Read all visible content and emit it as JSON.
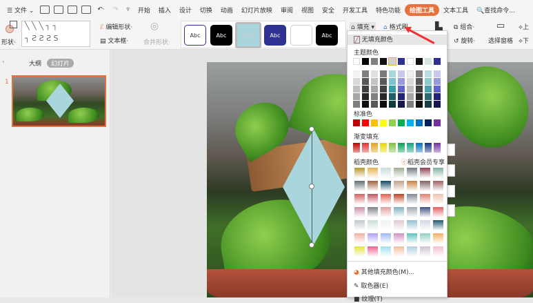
{
  "menubar": {
    "file": "文件",
    "tabs": [
      "开始",
      "插入",
      "设计",
      "切换",
      "动画",
      "幻灯片放映",
      "审阅",
      "视图",
      "安全",
      "开发工具",
      "特色功能"
    ],
    "active_tab": "绘图工具",
    "text_tools": "文本工具",
    "search": "查找命令..."
  },
  "ribbon": {
    "shape": "形状",
    "edit_shape": "编辑形状",
    "textbox": "文本框",
    "merge_shape": "合并形状",
    "style_label": "Abc",
    "fill": "填充",
    "format_painter": "格式刷",
    "group": "组合",
    "rotate": "旋转",
    "selection_pane": "选择窗格",
    "up": "上",
    "down": "下"
  },
  "left_panel": {
    "tab_outline": "大纲",
    "tab_slides": "幻灯片",
    "slide_number": "1"
  },
  "fill_menu": {
    "no_fill": "无填充颜色",
    "theme_colors": "主题颜色",
    "standard_colors": "标准色",
    "gradient_fill": "渐变填充",
    "docer_colors": "稻壳颜色",
    "docer_member": "稻壳会员专享",
    "more_colors": "其他填充颜色(M)...",
    "eyedropper": "取色器(E)",
    "texture": "纹理(T)"
  },
  "colors": {
    "theme": [
      "#ffffff",
      "#000000",
      "#808080",
      "#111111",
      "#d4d4c4",
      "#2e3192",
      "#ffffff",
      "#111111",
      "#d8e4e4",
      "#2e3192"
    ],
    "shades": [
      [
        "#f2f2f2",
        "#7f7f7f",
        "#e0e0e0",
        "#7a7a7a",
        "#a7d8dc",
        "#c9c9ef",
        "#f0f0f0",
        "#808080",
        "#b8dde0",
        "#c9c9ef"
      ],
      [
        "#d9d9d9",
        "#595959",
        "#c4c4c4",
        "#595959",
        "#7cc4cc",
        "#9999dd",
        "#d9d9d9",
        "#595959",
        "#8fc9cf",
        "#9999dd"
      ],
      [
        "#bfbfbf",
        "#404040",
        "#a6a6a6",
        "#404040",
        "#3a9ca6",
        "#6363c9",
        "#bfbfbf",
        "#404040",
        "#4aa3ab",
        "#6363c9"
      ],
      [
        "#a6a6a6",
        "#262626",
        "#808080",
        "#262626",
        "#1d5f66",
        "#23237a",
        "#a6a6a6",
        "#262626",
        "#2a6a70",
        "#23237a"
      ],
      [
        "#7f7f7f",
        "#0d0d0d",
        "#595959",
        "#0d0d0d",
        "#103a3e",
        "#17174f",
        "#7f7f7f",
        "#0d0d0d",
        "#173f43",
        "#17174f"
      ]
    ],
    "standard": [
      "#c00000",
      "#ff0000",
      "#ffc000",
      "#ffff00",
      "#92d050",
      "#00b050",
      "#00b0f0",
      "#0070c0",
      "#002060",
      "#7030a0"
    ],
    "gradient": [
      "#c00000",
      "#e03030",
      "#e0a020",
      "#e8d800",
      "#80c040",
      "#00a050",
      "#10a080",
      "#0070c0",
      "#103080",
      "#7030a0"
    ],
    "docer": [
      [
        "#b8962e",
        "#e4b050",
        "#c8dcdc",
        "#a0b090",
        "#707880",
        "#904050",
        "#80b0a0"
      ],
      [
        "#607070",
        "#a06040",
        "#104860",
        "#c0a090",
        "#c88040",
        "#806060",
        "#a06060"
      ],
      [
        "#d06060",
        "#c05060",
        "#e06050",
        "#c04020",
        "#808898",
        "#e08070",
        "#f0c0b0"
      ],
      [
        "#c890a8",
        "#808088",
        "#e0a0a0",
        "#80b0c0",
        "#a0a8b0",
        "#405080",
        "#e06060"
      ],
      [
        "#c0c8d0",
        "#c8e0d8",
        "#f0f0f0",
        "#e0c8d0",
        "#90c0d0",
        "#d0d8e0",
        "#205870"
      ],
      [
        "#f0b0a0",
        "#b0a0f0",
        "#a0b8f0",
        "#d090c0",
        "#60c0c0",
        "#90d0c0",
        "#f0b060"
      ],
      [
        "#e8e040",
        "#f06090",
        "#a0e0f0",
        "#f0c0a0",
        "#b0d0e0",
        "#d0c0d0",
        "#f0c0d0"
      ]
    ]
  }
}
